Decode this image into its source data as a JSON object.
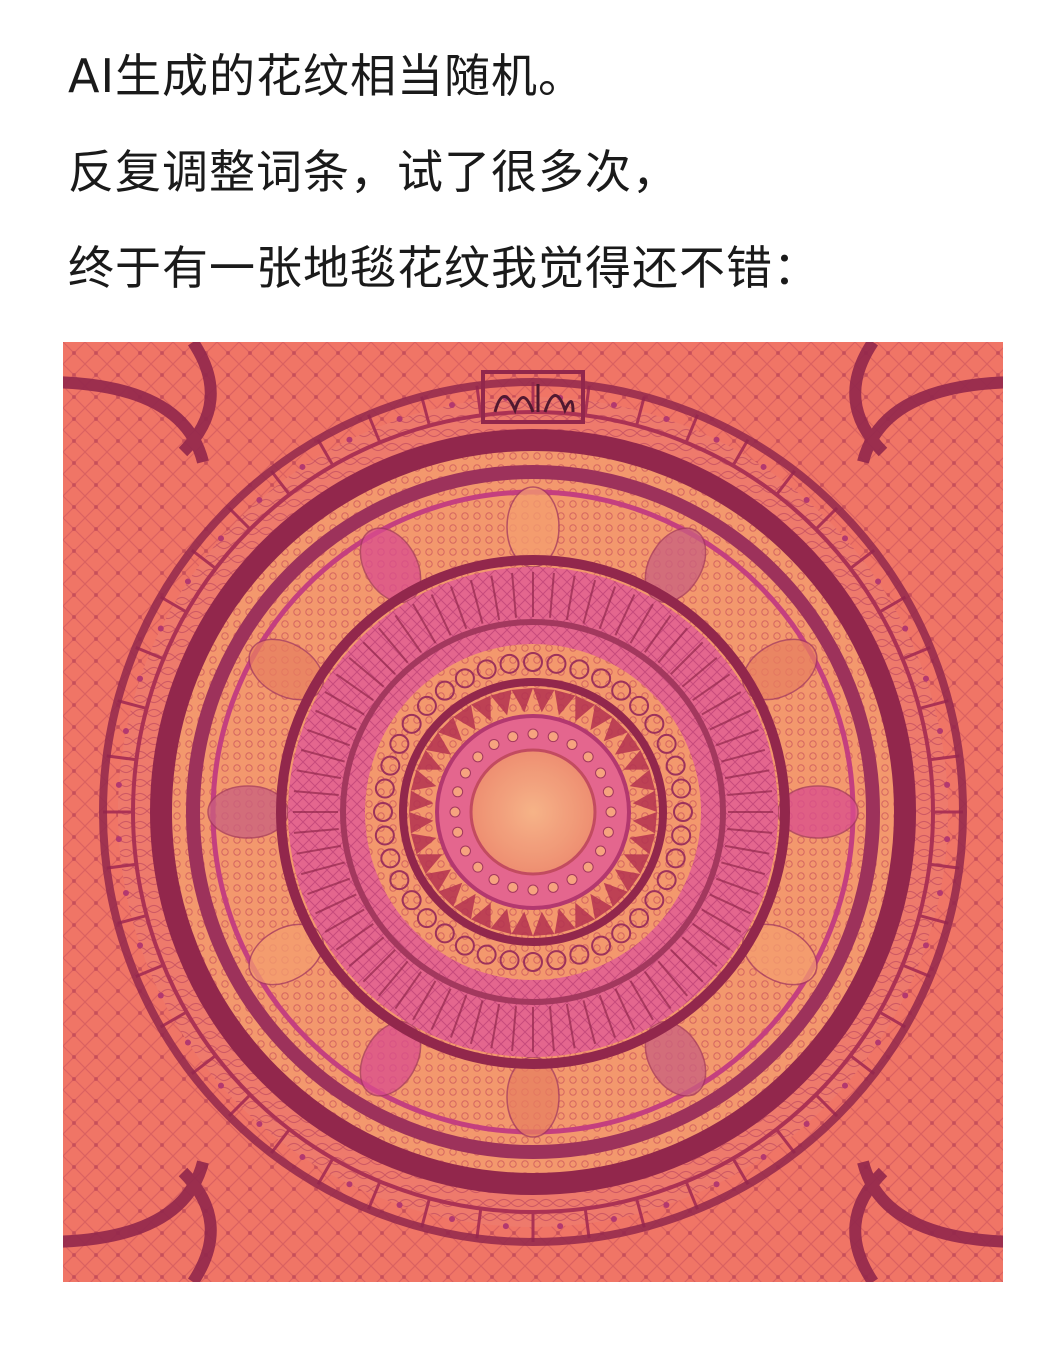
{
  "post": {
    "lines": [
      "AI生成的花纹相当随机。",
      "反复调整词条，试了很多次，",
      "终于有一张地毯花纹我觉得还不错："
    ]
  },
  "image": {
    "subject": "carpet-pattern",
    "colors": {
      "background": "#f07060",
      "primary_ring": "#8e1f45",
      "accent_pink": "#d9468a",
      "accent_orange": "#f59a6a",
      "center": "#f4a07a"
    }
  }
}
